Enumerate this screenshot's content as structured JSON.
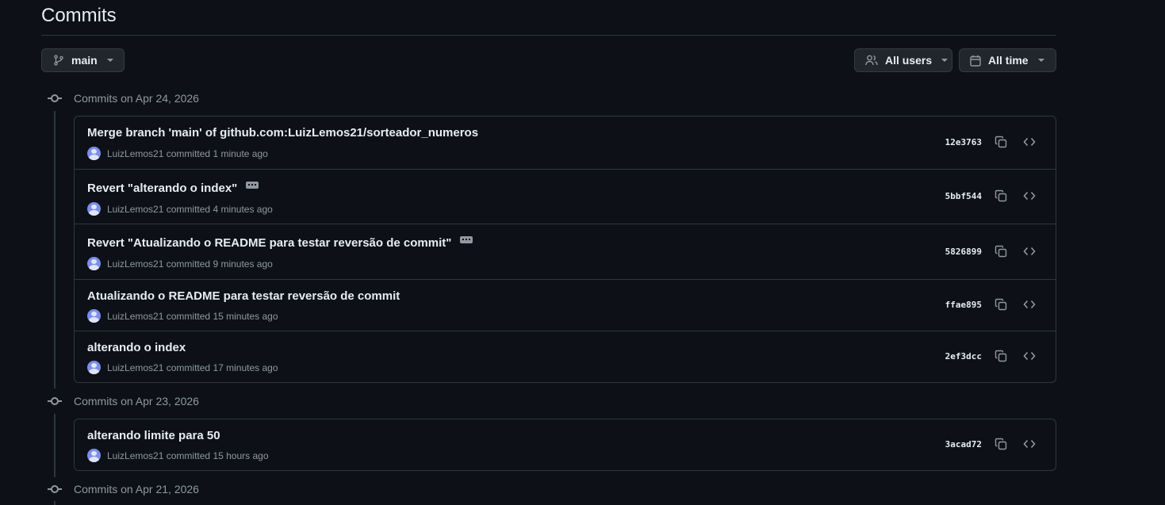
{
  "page": {
    "title": "Commits"
  },
  "filters": {
    "branch_label": "main",
    "users_label": "All users",
    "time_label": "All time"
  },
  "groups": [
    {
      "heading": "Commits on Apr 24, 2026",
      "commits": [
        {
          "message": "Merge branch 'main' of github.com:LuizLemos21/sorteador_numeros",
          "author": "LuizLemos21",
          "action": "committed",
          "time": "1 minute ago",
          "sha": "12e3763",
          "has_ellipsis": false
        },
        {
          "message": "Revert \"alterando o index\"",
          "author": "LuizLemos21",
          "action": "committed",
          "time": "4 minutes ago",
          "sha": "5bbf544",
          "has_ellipsis": true
        },
        {
          "message": "Revert \"Atualizando o README para testar reversão de commit\"",
          "author": "LuizLemos21",
          "action": "committed",
          "time": "9 minutes ago",
          "sha": "5826899",
          "has_ellipsis": true
        },
        {
          "message": "Atualizando o README para testar reversão de commit",
          "author": "LuizLemos21",
          "action": "committed",
          "time": "15 minutes ago",
          "sha": "ffae895",
          "has_ellipsis": false
        },
        {
          "message": "alterando o index",
          "author": "LuizLemos21",
          "action": "committed",
          "time": "17 minutes ago",
          "sha": "2ef3dcc",
          "has_ellipsis": false
        }
      ]
    },
    {
      "heading": "Commits on Apr 23, 2026",
      "commits": [
        {
          "message": "alterando limite para 50",
          "author": "LuizLemos21",
          "action": "committed",
          "time": "15 hours ago",
          "sha": "3acad72",
          "has_ellipsis": false
        }
      ]
    },
    {
      "heading": "Commits on Apr 21, 2026",
      "commits": []
    }
  ],
  "colors": {
    "background": "#0d1117",
    "border": "#30363d",
    "muted": "#9198a1",
    "text": "#e6edf3"
  },
  "icons": {
    "branch": "git-branch-icon",
    "users": "people-icon",
    "time": "calendar-icon",
    "copy": "copy-icon",
    "browse": "code-icon",
    "commit": "git-commit-icon"
  }
}
